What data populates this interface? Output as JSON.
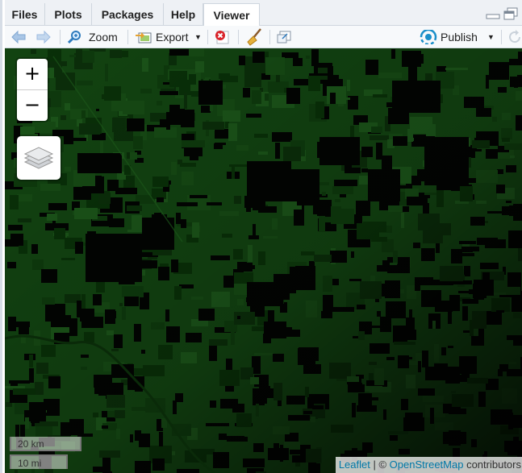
{
  "tabs": [
    {
      "label": "Files"
    },
    {
      "label": "Plots"
    },
    {
      "label": "Packages"
    },
    {
      "label": "Help"
    },
    {
      "label": "Viewer"
    }
  ],
  "toolbar": {
    "zoom_label": "Zoom",
    "export_label": "Export",
    "publish_label": "Publish"
  },
  "map": {
    "zoom_in": "+",
    "zoom_out": "−",
    "scale_metric": "20 km",
    "scale_imperial": "10 mi",
    "attribution": {
      "leaflet": "Leaflet",
      "separator": " | © ",
      "osm": "OpenStreetMap",
      "suffix": " contributors"
    }
  },
  "icons": {
    "back": "back-arrow-icon",
    "forward": "forward-arrow-icon",
    "zoom": "magnifier-icon",
    "export": "export-icon",
    "clear": "delete-icon",
    "broom": "broom-icon",
    "popout": "popout-icon",
    "publish": "publish-icon",
    "refresh": "refresh-icon",
    "layers": "layers-icon",
    "minimize": "minimize-icon",
    "maximize": "maximize-icon"
  },
  "colors": {
    "map_green_dark": "#0f3a0e",
    "map_black": "#020402",
    "link": "#0078a8",
    "delete_red": "#d9232a",
    "publish_blue": "#1a8fc9"
  }
}
